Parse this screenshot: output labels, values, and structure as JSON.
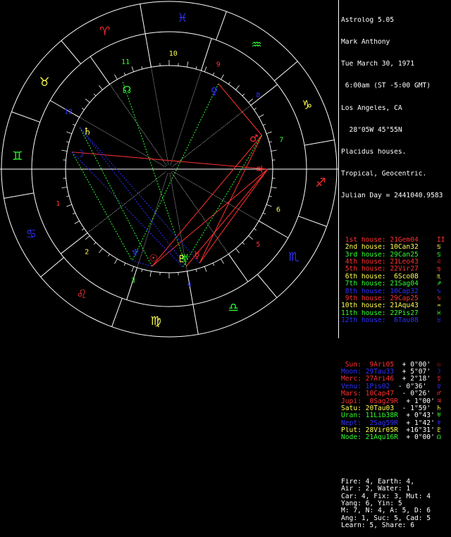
{
  "header": {
    "program": "Astrolog 5.05",
    "name": "Mark Anthony",
    "date": "Tue March 30, 1971",
    "time": " 6:00am (ST -5:00 GMT)",
    "place": "Los Angeles, CA",
    "coords": "  28°05W 45°55N",
    "house_system": "Placidus houses.",
    "zodiac": "Tropical, Geocentric.",
    "julian": "Julian Day = 2441040.9583"
  },
  "houses": [
    {
      "label": " 1st house:",
      "value": " 21Gem04",
      "color": "#ff3030",
      "sign": "II"
    },
    {
      "label": " 2nd house:",
      "value": " 10Can32",
      "color": "#ffff50",
      "sign": "♋"
    },
    {
      "label": " 3rd house:",
      "value": " 29Can25",
      "color": "#30ff30",
      "sign": "♋"
    },
    {
      "label": " 4th house:",
      "value": " 21Leo43",
      "color": "#ff3030",
      "sign": "♌"
    },
    {
      "label": " 5th house:",
      "value": " 22Vir27",
      "color": "#ff3030",
      "sign": "♍"
    },
    {
      "label": " 6th house:",
      "value": "  6Sco08",
      "color": "#ffff50",
      "sign": "♏"
    },
    {
      "label": " 7th house:",
      "value": " 21Sag04",
      "color": "#30ff30",
      "sign": "♐"
    },
    {
      "label": " 8th house:",
      "value": " 10Cap32",
      "color": "#3030ff",
      "sign": "♑"
    },
    {
      "label": " 9th house:",
      "value": " 29Cap25",
      "color": "#ff3030",
      "sign": "♑"
    },
    {
      "label": "10th house:",
      "value": " 21Aqu43",
      "color": "#ffff50",
      "sign": "♒"
    },
    {
      "label": "11th house:",
      "value": " 22Pis27",
      "color": "#30ff30",
      "sign": "♓"
    },
    {
      "label": "12th house:",
      "value": "  6Tau08",
      "color": "#3030ff",
      "sign": "♉"
    }
  ],
  "planets": [
    {
      "name": " Sun:",
      "pos": "  9Ari05",
      "lat": "  + 0°00'",
      "color": "#ff3030",
      "glyph": "☉"
    },
    {
      "name": "Moon:",
      "pos": " 29Tau33",
      "lat": "  + 5°07'",
      "color": "#3030ff",
      "glyph": "☽"
    },
    {
      "name": "Merc:",
      "pos": " 27Ari46",
      "lat": "  + 2°18'",
      "color": "#ff3030",
      "glyph": "☿"
    },
    {
      "name": "Venu:",
      "pos": " 1Pis02",
      "lat": "  - 0°36'",
      "color": "#3030ff",
      "glyph": "♀"
    },
    {
      "name": "Mars:",
      "pos": " 10Cap47",
      "lat": "  - 0°26'",
      "color": "#ff3030",
      "glyph": "♂"
    },
    {
      "name": "Jupi:",
      "pos": "  0Sag29R",
      "lat": "  + 1°00'",
      "color": "#ff3030",
      "glyph": "♃"
    },
    {
      "name": "Satu:",
      "pos": " 20Tau03",
      "lat": "  - 1°59'",
      "color": "#ffff50",
      "glyph": "♄"
    },
    {
      "name": "Uran:",
      "pos": " 11Lib38R",
      "lat": "  + 0°43'",
      "color": "#30ff30",
      "glyph": "♅"
    },
    {
      "name": "Nept:",
      "pos": "  2Sag59R",
      "lat": "  + 1°42'",
      "color": "#3030ff",
      "glyph": "♆"
    },
    {
      "name": "Plut:",
      "pos": " 28Vir05R",
      "lat": "  +16°31'",
      "color": "#ffff50",
      "glyph": "♇"
    },
    {
      "name": "Node:",
      "pos": " 21Aqu16R",
      "lat": "  + 0°00'",
      "color": "#30ff30",
      "glyph": "☊"
    }
  ],
  "summary": [
    "Fire: 4, Earth: 4,",
    "Air : 2, Water: 1",
    "Car: 4, Fix: 3, Mut: 4",
    "Yang: 6, Yin: 5",
    "M: 7, N: 4, A: 5, D: 6",
    "Ang: 1, Suc: 5, Cad: 5",
    "Learn: 5, Share: 6"
  ],
  "house_numbers": [
    "1",
    "2",
    "3",
    "4",
    "5",
    "6",
    "7",
    "8",
    "9",
    "10",
    "11",
    "12"
  ],
  "colors": {
    "red": "#ff3030",
    "yellow": "#ffff50",
    "green": "#30ff30",
    "blue": "#3030ff",
    "white": "#ffffff",
    "black": "#000000"
  }
}
